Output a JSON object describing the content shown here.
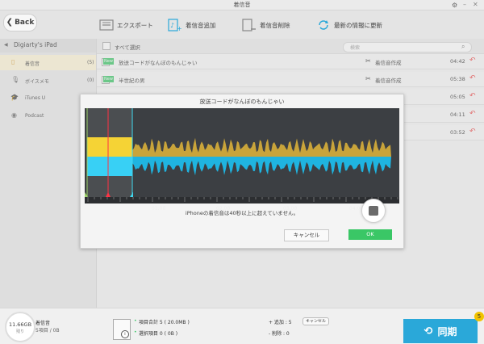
{
  "window": {
    "title": "着信音"
  },
  "nav": {
    "back_label": "Back"
  },
  "toolbar": {
    "export_label": "エクスポート",
    "add_label": "着信音追加",
    "delete_label": "着信音削除",
    "refresh_label": "最新の情報に更新"
  },
  "sidebar": {
    "device_name": "Digiarty's iPad",
    "items": [
      {
        "label": "着信音",
        "count": "(5)",
        "icon": "bell-icon"
      },
      {
        "label": "ボイスメモ",
        "count": "(0)",
        "icon": "microphone-icon"
      },
      {
        "label": "iTunes U",
        "count": "",
        "icon": "graduation-cap-icon"
      },
      {
        "label": "Podcast",
        "count": "",
        "icon": "podcast-icon"
      }
    ]
  },
  "list": {
    "select_all_label": "すべて選択",
    "search_placeholder": "検索",
    "new_badge": "New",
    "make_ringtone_label": "着信音作成",
    "rows": [
      {
        "title": "放送コードがなんぼのもんじゃい",
        "duration": "04:42"
      },
      {
        "title": "半世紀の男",
        "duration": "05:38"
      },
      {
        "title": "",
        "duration": "05:05"
      },
      {
        "title": "",
        "duration": "04:11"
      },
      {
        "title": "",
        "duration": "03:52"
      }
    ]
  },
  "dialog": {
    "title": "放送コードがなんぼのもんじゃい",
    "ticks": [
      "01:00",
      "02:00",
      "03:00",
      "04:00"
    ],
    "message": "iPhoneの着信音は40秒以上に超えていません。",
    "cancel_label": "キャンセル",
    "ok_label": "OK"
  },
  "footer": {
    "storage_used": "11.66GB",
    "storage_sub": "残り",
    "category": "着信音",
    "category_detail": "5項目 / 0B",
    "total_items": "項目合計 5 ( 20.0MB )",
    "selected_items": "選択項目 0 ( 0B )",
    "add_label": "+ 追加 : 5",
    "cancel_label": "キャンセル",
    "delete_label": "- 削除 : 0",
    "sync_label": "同期",
    "sync_badge": "5"
  },
  "colors": {
    "accent": "#2aa8d9",
    "ok": "#3ac766",
    "wave_gold": "#c9a43a",
    "wave_blue": "#1fb4e0",
    "sync_badge": "#f2c300"
  }
}
